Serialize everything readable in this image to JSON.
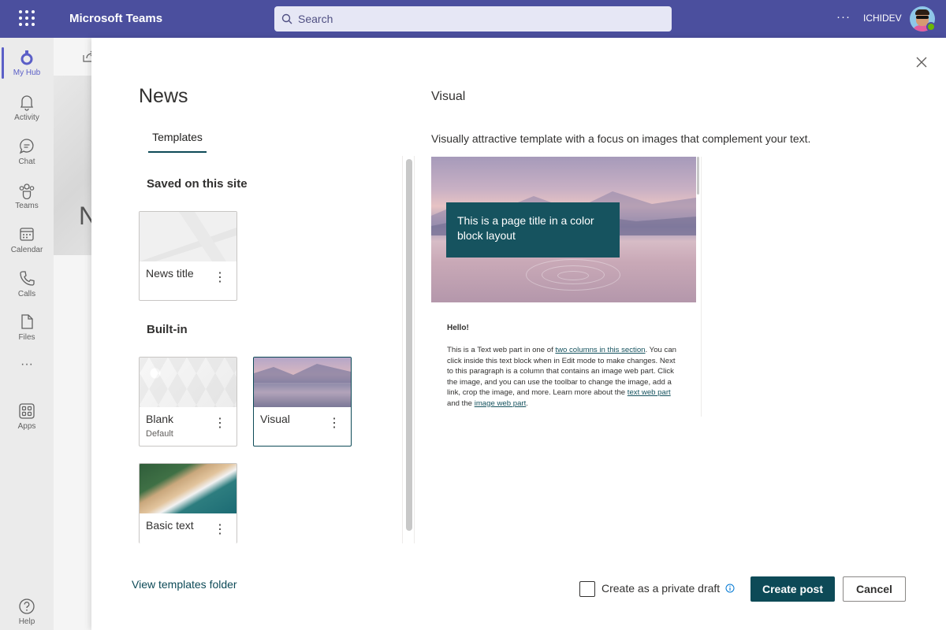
{
  "topbar": {
    "app_title": "Microsoft Teams",
    "search_placeholder": "Search",
    "more": "···",
    "tenant": "ICHIDEV"
  },
  "rail": {
    "items": [
      {
        "label": "My Hub",
        "icon": "my-hub-icon"
      },
      {
        "label": "Activity",
        "icon": "bell-icon"
      },
      {
        "label": "Chat",
        "icon": "chat-icon"
      },
      {
        "label": "Teams",
        "icon": "teams-icon"
      },
      {
        "label": "Calendar",
        "icon": "calendar-icon"
      },
      {
        "label": "Calls",
        "icon": "phone-icon"
      },
      {
        "label": "Files",
        "icon": "file-icon"
      },
      {
        "label": "···",
        "icon": "more-icon"
      },
      {
        "label": "Apps",
        "icon": "apps-icon"
      },
      {
        "label": "Help",
        "icon": "help-icon"
      }
    ]
  },
  "background": {
    "heading_initial": "N"
  },
  "panel": {
    "title": "News",
    "tab_templates": "Templates",
    "section_saved": "Saved on this site",
    "section_builtin": "Built-in",
    "cards": [
      {
        "name": "News title",
        "subtitle": ""
      },
      {
        "name": "Blank",
        "subtitle": "Default"
      },
      {
        "name": "Visual",
        "subtitle": ""
      },
      {
        "name": "Basic text",
        "subtitle": ""
      }
    ],
    "more_glyph": "⋮"
  },
  "preview": {
    "title": "Visual",
    "description": "Visually attractive template with a focus on images that complement your text.",
    "block_title": "This is a page title in a color block layout",
    "hello": "Hello!",
    "body_1": "This is a Text web part in one of ",
    "link_1": "two columns in this section",
    "body_2": ". You can click inside this text block when in Edit mode to make changes. Next to this paragraph is a column that contains an image web part. Click the image, and you can use the toolbar to change the image, add a link, crop the image, and more. Learn more about the ",
    "link_2": "text web part",
    "body_3": " and the ",
    "link_3": "image web part",
    "body_4": "."
  },
  "footer": {
    "view_folder": "View templates folder",
    "private_draft": "Create as a private draft",
    "create_post": "Create post",
    "cancel": "Cancel"
  },
  "colors": {
    "topbar": "#4b4f9e",
    "accent": "#0d4a57",
    "rail_active": "#5b5fc7"
  }
}
